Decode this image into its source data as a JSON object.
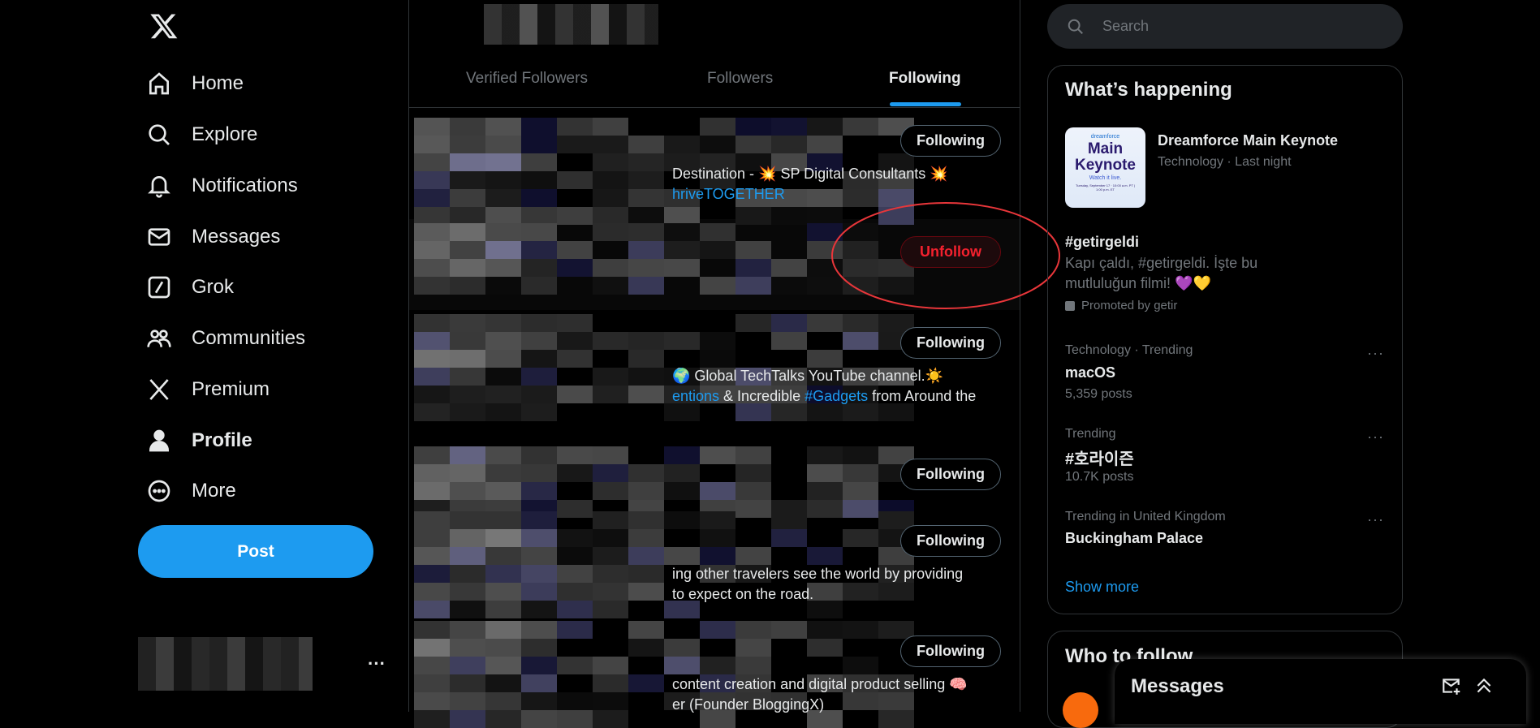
{
  "nav": {
    "logo": "X",
    "items": [
      {
        "label": "Home",
        "icon": "home-icon"
      },
      {
        "label": "Explore",
        "icon": "search-icon"
      },
      {
        "label": "Notifications",
        "icon": "bell-icon"
      },
      {
        "label": "Messages",
        "icon": "mail-icon"
      },
      {
        "label": "Grok",
        "icon": "grok-icon"
      },
      {
        "label": "Communities",
        "icon": "people-icon"
      },
      {
        "label": "Premium",
        "icon": "x-icon"
      },
      {
        "label": "Profile",
        "icon": "person-icon"
      },
      {
        "label": "More",
        "icon": "more-circle-icon"
      }
    ],
    "post_label": "Post",
    "account_more": "···"
  },
  "tabs": [
    {
      "label": "Verified Followers"
    },
    {
      "label": "Followers"
    },
    {
      "label": "Following",
      "active": true
    }
  ],
  "rows": [
    {
      "button": "Following",
      "bio": [
        {
          "t": "Destination - 💥 SP Digital Consultants 💥"
        },
        {
          "t": "hriveTOGETHER",
          "link": true
        }
      ]
    },
    {
      "button": "Unfollow",
      "bio": []
    },
    {
      "button": "Following",
      "bio": [
        {
          "t": "🌍 Global TechTalks YouTube channel.☀️"
        },
        {
          "parts": [
            {
              "t": "entions",
              "link": true
            },
            {
              "t": " & Incredible "
            },
            {
              "t": "#Gadgets",
              "link": true
            },
            {
              "t": " from Around the"
            }
          ]
        }
      ]
    },
    {
      "button": "Following",
      "bio": []
    },
    {
      "button": "Following",
      "bio": [
        {
          "t": "ing other travelers see the world by providing"
        },
        {
          "t": "to expect on the road."
        }
      ]
    },
    {
      "button": "Following",
      "bio": [
        {
          "t": "content creation and digital product selling 🧠"
        },
        {
          "t": "er (Founder BloggingX)"
        }
      ]
    }
  ],
  "search": {
    "placeholder": "Search"
  },
  "trends": {
    "title": "What’s happening",
    "featured": {
      "title": "Dreamforce Main Keynote",
      "meta": "Technology · Last night",
      "image_brand": "dreamforce",
      "image_title": "Main Keynote",
      "image_sub": "Watch it live.",
      "image_date": "Tuesday, September 17 · 10:00 a.m. PT | 1:00 p.m. ET"
    },
    "promo": {
      "title": "#getirgeldi",
      "text": "Kapı çaldı, #getirgeldi. İşte bu mutluluğun filmi! 💜💛",
      "by": "Promoted by getir"
    },
    "items": [
      {
        "meta": "Technology · Trending",
        "title": "macOS",
        "count": "5,359 posts"
      },
      {
        "meta": "Trending",
        "title": "#호라이즌",
        "count": "10.7K posts"
      },
      {
        "meta": "Trending in United Kingdom",
        "title": "Buckingham Palace",
        "count": ""
      }
    ],
    "show_more": "Show more",
    "more": "···"
  },
  "who_to_follow": {
    "title": "Who to follow"
  },
  "messages": {
    "title": "Messages"
  },
  "colors": {
    "accent": "#1d9bf0",
    "unfollow": "#f4212e",
    "annotation": "#e8363a"
  }
}
